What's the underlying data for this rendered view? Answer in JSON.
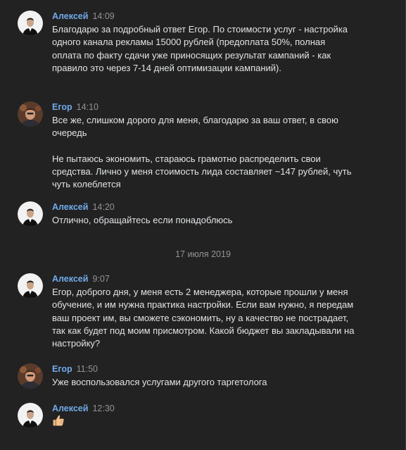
{
  "messages": [
    {
      "author": "Алексей",
      "time": "14:09",
      "paragraphs": [
        "Благодарю за подробный ответ Егор. По стоимости услуг - настройка одного канала рекламы 15000 рублей (предоплата 50%, полная оплата по факту сдачи уже приносящих результат кампаний - как правило это через 7-14 дней оптимизации кампаний)."
      ]
    },
    {
      "author": "Егор",
      "time": "14:10",
      "paragraphs": [
        "Все же, слишком дорого для меня, благодарю за ваш ответ, в свою очередь",
        "Не пытаюсь экономить, стараюсь грамотно распределить свои средства. Лично у меня стоимость лида составляет ~147 рублей, чуть чуть колеблется"
      ]
    },
    {
      "author": "Алексей",
      "time": "14:20",
      "paragraphs": [
        "Отлично, обращайтесь если понадоблюсь"
      ]
    },
    {
      "author": "Алексей",
      "time": "9:07",
      "paragraphs": [
        "Егор, доброго дня, у меня есть 2 менеджера, которые прошли у меня обучение, и им нужна практика настройки. Если вам нужно, я передам ваш проект им, вы сможете сэкономить, ну а качество не пострадает, так как будет под моим присмотром. Какой бюджет вы закладывали на настройку?"
      ]
    },
    {
      "author": "Егор",
      "time": "11:50",
      "paragraphs": [
        "Уже воспользовался услугами другого таргетолога"
      ]
    },
    {
      "author": "Алексей",
      "time": "12:30",
      "emoji": "thumbs-up-icon"
    }
  ],
  "date_separator": "17 июля 2019",
  "colors": {
    "background": "#222222",
    "author": "#71aaeb",
    "time": "#939393",
    "text": "#e1e3e6"
  }
}
